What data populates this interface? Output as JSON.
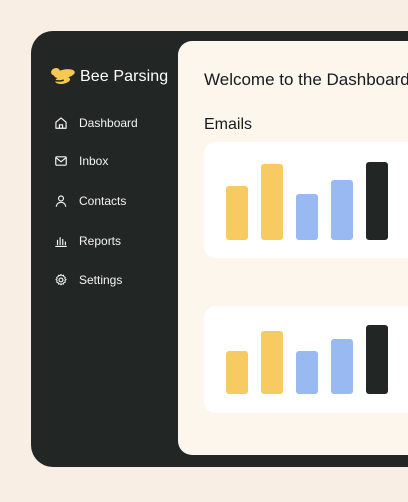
{
  "brand": {
    "name": "Bee Parsing",
    "logo_icon": "bee-icon",
    "accent": "#f5c84f"
  },
  "sidebar": {
    "background": "#222624",
    "items": [
      {
        "label": "Dashboard",
        "icon": "home-icon"
      },
      {
        "label": "Inbox",
        "icon": "mail-icon"
      },
      {
        "label": "Contacts",
        "icon": "user-icon"
      },
      {
        "label": "Reports",
        "icon": "bar-chart-icon"
      },
      {
        "label": "Settings",
        "icon": "gear-icon"
      }
    ]
  },
  "main": {
    "title": "Welcome to the Dashboard",
    "section_title": "Emails"
  },
  "colors": {
    "page_background": "#f9eee3",
    "panel_background": "#fdf6ec",
    "card_background": "#ffffff",
    "yellow_bar": "#f8ca62",
    "blue_bar": "#99b9f2",
    "black_bar": "#222624"
  },
  "chart_data": [
    {
      "type": "bar",
      "categories": [
        "",
        "",
        "",
        "",
        ""
      ],
      "values": [
        54,
        76,
        46,
        60,
        78
      ],
      "colors": [
        "#f8ca62",
        "#f8ca62",
        "#99b9f2",
        "#99b9f2",
        "#222624"
      ],
      "title": "",
      "xlabel": "",
      "ylabel": "",
      "ylim": [
        0,
        100
      ],
      "grid": false,
      "legend": "none"
    },
    {
      "type": "bar",
      "categories": [
        "",
        "",
        "",
        "",
        ""
      ],
      "values": [
        46,
        68,
        46,
        59,
        74
      ],
      "colors": [
        "#f8ca62",
        "#f8ca62",
        "#99b9f2",
        "#99b9f2",
        "#222624"
      ],
      "title": "",
      "xlabel": "",
      "ylabel": "",
      "ylim": [
        0,
        100
      ],
      "grid": false,
      "legend": "none"
    }
  ]
}
